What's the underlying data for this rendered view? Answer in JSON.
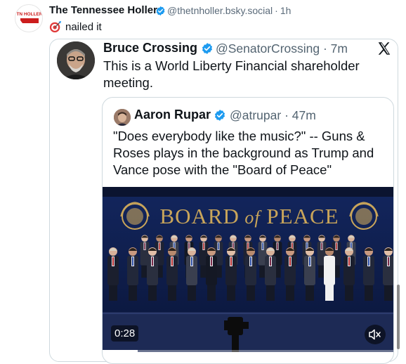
{
  "outer_post": {
    "display_name": "The Tennessee Holler",
    "handle": "@thetnholler.bsky.social",
    "time": "1h",
    "text": "nailed it",
    "avatar_text": "TN HOLLER"
  },
  "quoted_post": {
    "display_name": "Bruce Crossing",
    "handle": "@SenatorCrossing",
    "time": "7m",
    "text": "This is a World Liberty Financial shareholder meeting."
  },
  "inner_quoted_post": {
    "display_name": "Aaron Rupar",
    "handle": "@atrupar",
    "time": "47m",
    "text": "\"Does everybody like the music?\" -- Guns & Roses plays in the background as Trump and Vance pose with the \"Board of Peace\"",
    "video": {
      "banner_text": "BOARD of PEACE",
      "duration": "0:28",
      "progress_fraction": 0.12
    }
  },
  "colors": {
    "verified": "#1d9bf0",
    "handle": "#536471",
    "border": "#cfd9de",
    "video_backdrop": "#0d1b4a",
    "banner_gold": "#c9a55a"
  },
  "icons": [
    "verified-badge-icon",
    "x-logo-icon",
    "target-emoji-icon",
    "mute-icon"
  ]
}
